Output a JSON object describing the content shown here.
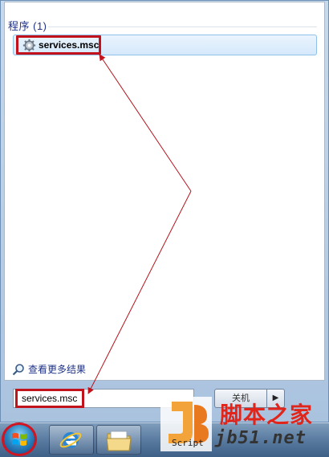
{
  "start_menu": {
    "group_heading": "程序 (1)",
    "results": [
      {
        "label": "services.msc",
        "icon": "gear-icon"
      }
    ],
    "see_more": "查看更多结果",
    "search": {
      "value": "services.msc"
    },
    "shutdown_label": "关机",
    "shutdown_arrow": "▶"
  },
  "taskbar": {
    "start_button": "windows-start-orb",
    "pinned": [
      "internet-explorer-icon",
      "windows-explorer-icon"
    ]
  },
  "watermark": {
    "text": "脚本之家",
    "domain": "jb51.net",
    "logo_caption": "Script"
  },
  "annotation_color": "#c2121c"
}
